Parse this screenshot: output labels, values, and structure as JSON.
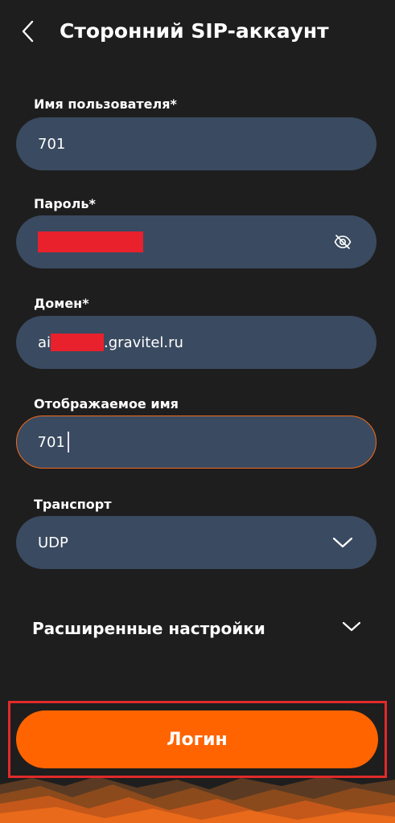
{
  "header": {
    "title": "Сторонний SIP-аккаунт",
    "back_icon": "chevron-left-icon"
  },
  "form": {
    "username": {
      "label": "Имя пользователя*",
      "value": "701"
    },
    "password": {
      "label": "Пароль*",
      "value_redacted": true,
      "visibility_icon": "eye-off-icon"
    },
    "domain": {
      "label": "Домен*",
      "value_prefix": "ai",
      "value_suffix": ".gravitel.ru"
    },
    "display_name": {
      "label": "Отображаемое имя",
      "value": "701"
    },
    "transport": {
      "label": "Транспорт",
      "value": "UDP",
      "dropdown_icon": "chevron-down-icon"
    }
  },
  "advanced": {
    "label": "Расширенные настройки",
    "icon": "chevron-down-icon"
  },
  "login": {
    "label": "Логин"
  },
  "colors": {
    "background": "#1e1e1e",
    "field_bg": "#3a4a60",
    "accent": "#ff6400",
    "focus_border": "#f26b1d",
    "redaction": "#e8212d",
    "highlight_frame": "#e22a2a"
  }
}
